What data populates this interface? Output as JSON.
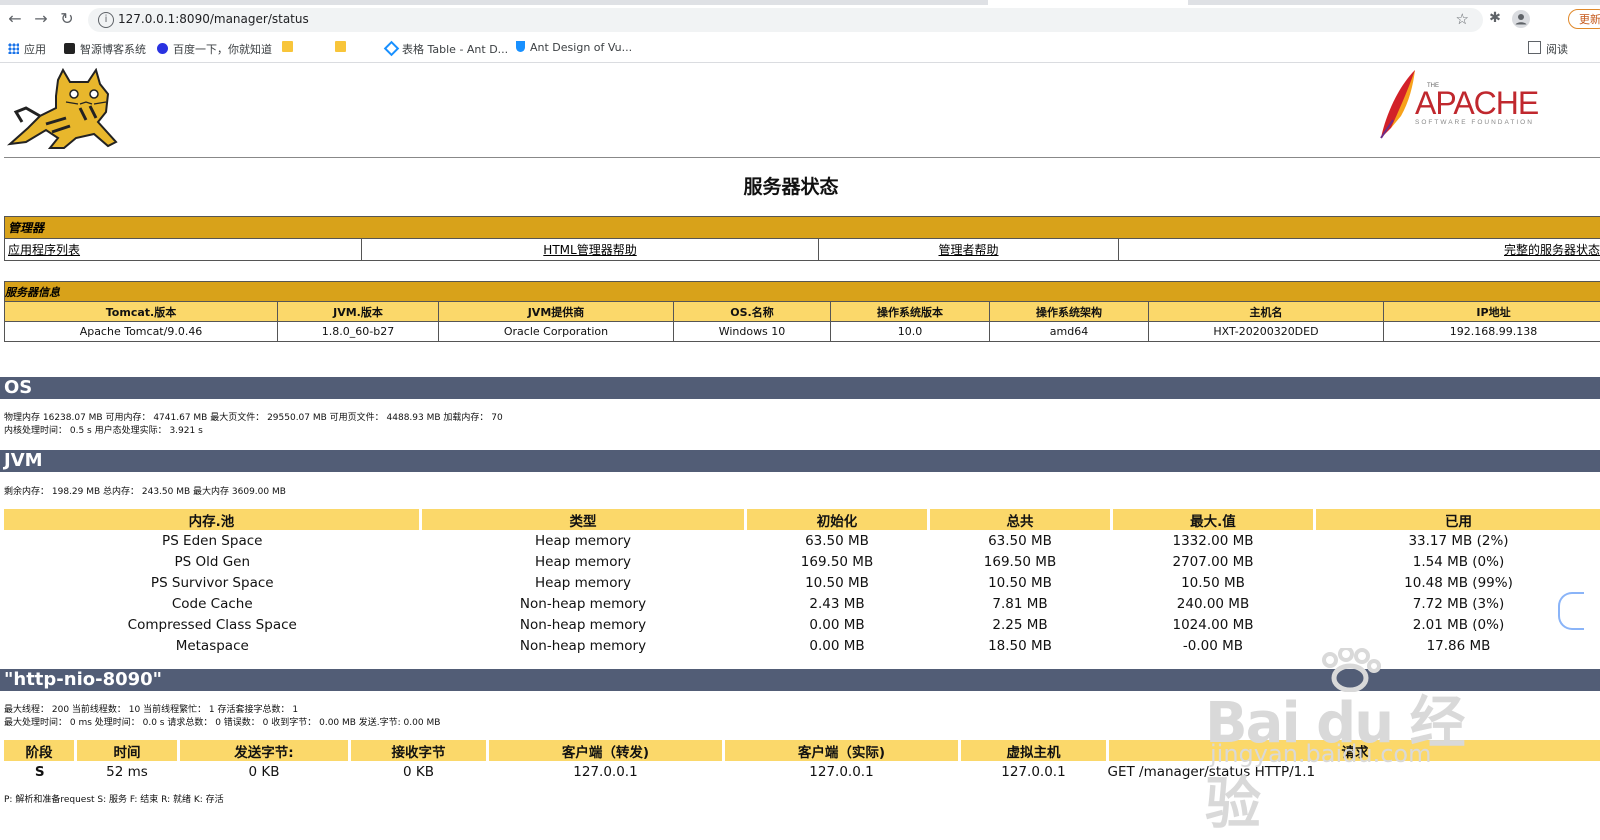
{
  "browser": {
    "url": "127.0.0.1:8090/manager/status",
    "update_label": "更新",
    "bookmarks": [
      {
        "label": "应用"
      },
      {
        "label": "智源博客系统"
      },
      {
        "label": "百度一下，你就知道"
      },
      {
        "label": ""
      },
      {
        "label": ""
      },
      {
        "label": "表格 Table - Ant D..."
      },
      {
        "label": "Ant Design of Vu..."
      }
    ],
    "reading_list": "阅读"
  },
  "page": {
    "title": "服务器状态",
    "manager": {
      "heading": "管理器",
      "links": [
        "应用程序列表",
        "HTML管理器帮助",
        "管理者帮助",
        "完整的服务器状态"
      ]
    },
    "server_info": {
      "heading": "服务器信息",
      "headers": [
        "Tomcat.版本",
        "JVM.版本",
        "JVM提供商",
        "OS.名称",
        "操作系统版本",
        "操作系统架构",
        "主机名",
        "IP地址"
      ],
      "values": [
        "Apache Tomcat/9.0.46",
        "1.8.0_60-b27",
        "Oracle Corporation",
        "Windows 10",
        "10.0",
        "amd64",
        "HXT-20200320DED",
        "192.168.99.138"
      ]
    },
    "os": {
      "heading": "OS",
      "line1": "物理内存 16238.07 MB 可用内存： 4741.67 MB 最大页文件： 29550.07 MB 可用页文件： 4488.93 MB 加载内存： 70",
      "line2": "内核处理时间： 0.5 s 用户态处理实际： 3.921 s"
    },
    "jvm": {
      "heading": "JVM",
      "line1": "剩余内存： 198.29 MB 总内存： 243.50 MB 最大内存 3609.00 MB",
      "headers": [
        "内存.池",
        "类型",
        "初始化",
        "总共",
        "最大.值",
        "已用"
      ],
      "rows": [
        [
          "PS Eden Space",
          "Heap memory",
          "63.50 MB",
          "63.50 MB",
          "1332.00 MB",
          "33.17 MB (2%)"
        ],
        [
          "PS Old Gen",
          "Heap memory",
          "169.50 MB",
          "169.50 MB",
          "2707.00 MB",
          "1.54 MB (0%)"
        ],
        [
          "PS Survivor Space",
          "Heap memory",
          "10.50 MB",
          "10.50 MB",
          "10.50 MB",
          "10.48 MB (99%)"
        ],
        [
          "Code Cache",
          "Non-heap memory",
          "2.43 MB",
          "7.81 MB",
          "240.00 MB",
          "7.72 MB (3%)"
        ],
        [
          "Compressed Class Space",
          "Non-heap memory",
          "0.00 MB",
          "2.25 MB",
          "1024.00 MB",
          "2.01 MB (0%)"
        ],
        [
          "Metaspace",
          "Non-heap memory",
          "0.00 MB",
          "18.50 MB",
          "-0.00 MB",
          "17.86 MB"
        ]
      ]
    },
    "connector": {
      "heading": "\"http-nio-8090\"",
      "line1": "最大线程： 200 当前线程数： 10 当前线程繁忙： 1 存活套接字总数： 1",
      "line2": "最大处理时间： 0 ms 处理时间： 0.0 s 请求总数： 0 错误数： 0 收到字节： 0.00 MB 发送.字节: 0.00 MB",
      "headers": [
        "阶段",
        "时间",
        "发送字节:",
        "接收字节",
        "客户端（转发)",
        "客户端（实际)",
        "虚拟主机",
        "请求"
      ],
      "row": [
        "S",
        "52 ms",
        "0 KB",
        "0 KB",
        "127.0.0.1",
        "127.0.0.1",
        "127.0.0.1",
        "GET /manager/status HTTP/1.1"
      ],
      "legend": "P: 解析和准备request S: 服务 F: 结束 R: 就绪 K: 存活"
    },
    "watermark": {
      "brand": "Bai du 经验",
      "url": "jingyan.baidu.com"
    }
  }
}
